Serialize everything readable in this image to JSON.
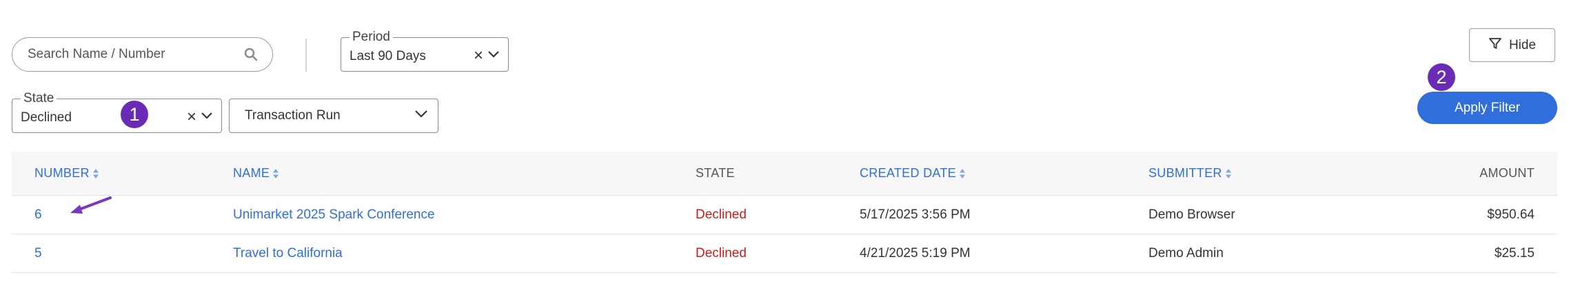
{
  "search": {
    "placeholder": "Search Name / Number",
    "icon": "search-icon"
  },
  "filters": {
    "period": {
      "legend": "Period",
      "value": "Last 90 Days"
    },
    "state": {
      "legend": "State",
      "value": "Declined"
    },
    "transaction_run": {
      "value": "Transaction Run"
    }
  },
  "badges": {
    "one": "1",
    "two": "2"
  },
  "buttons": {
    "hide": "Hide",
    "apply": "Apply Filter"
  },
  "table": {
    "headers": {
      "number": "NUMBER",
      "name": "NAME",
      "state": "STATE",
      "created_date": "CREATED DATE",
      "submitter": "SUBMITTER",
      "amount": "AMOUNT"
    },
    "rows": [
      {
        "number": "6",
        "name": "Unimarket 2025 Spark Conference",
        "state": "Declined",
        "created_date": "5/17/2025 3:56 PM",
        "submitter": "Demo Browser",
        "amount": "$950.64"
      },
      {
        "number": "5",
        "name": "Travel to California",
        "state": "Declined",
        "created_date": "4/21/2025 5:19 PM",
        "submitter": "Demo Admin",
        "amount": "$25.15"
      }
    ]
  },
  "colors": {
    "accent": "#2f6edb",
    "declined": "#cc1a1a",
    "badge": "#6a2bb5"
  }
}
